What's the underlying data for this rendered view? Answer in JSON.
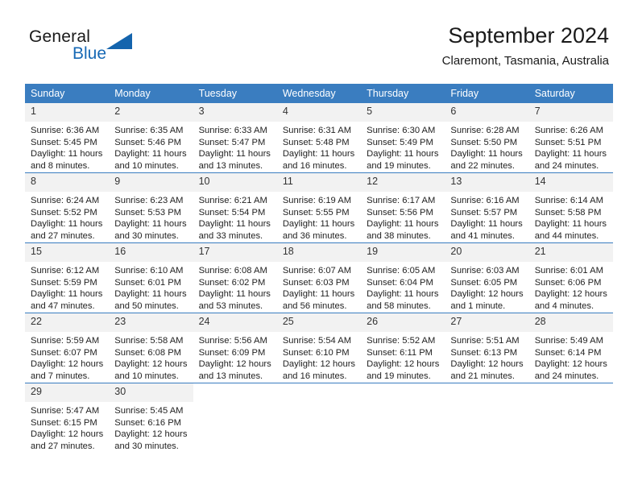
{
  "brand": {
    "name_part1": "General",
    "name_part2": "Blue",
    "triangle_color": "#1464ad",
    "blue_text_color": "#1769b5"
  },
  "header": {
    "title": "September 2024",
    "subtitle": "Claremont, Tasmania, Australia"
  },
  "calendar": {
    "header_bg": "#3a7dc0",
    "header_text_color": "#ffffff",
    "daynum_bg": "#f2f2f2",
    "weekday_headers": [
      "Sunday",
      "Monday",
      "Tuesday",
      "Wednesday",
      "Thursday",
      "Friday",
      "Saturday"
    ],
    "weeks": [
      [
        {
          "day": "1",
          "sunrise": "Sunrise: 6:36 AM",
          "sunset": "Sunset: 5:45 PM",
          "daylight1": "Daylight: 11 hours",
          "daylight2": "and 8 minutes."
        },
        {
          "day": "2",
          "sunrise": "Sunrise: 6:35 AM",
          "sunset": "Sunset: 5:46 PM",
          "daylight1": "Daylight: 11 hours",
          "daylight2": "and 10 minutes."
        },
        {
          "day": "3",
          "sunrise": "Sunrise: 6:33 AM",
          "sunset": "Sunset: 5:47 PM",
          "daylight1": "Daylight: 11 hours",
          "daylight2": "and 13 minutes."
        },
        {
          "day": "4",
          "sunrise": "Sunrise: 6:31 AM",
          "sunset": "Sunset: 5:48 PM",
          "daylight1": "Daylight: 11 hours",
          "daylight2": "and 16 minutes."
        },
        {
          "day": "5",
          "sunrise": "Sunrise: 6:30 AM",
          "sunset": "Sunset: 5:49 PM",
          "daylight1": "Daylight: 11 hours",
          "daylight2": "and 19 minutes."
        },
        {
          "day": "6",
          "sunrise": "Sunrise: 6:28 AM",
          "sunset": "Sunset: 5:50 PM",
          "daylight1": "Daylight: 11 hours",
          "daylight2": "and 22 minutes."
        },
        {
          "day": "7",
          "sunrise": "Sunrise: 6:26 AM",
          "sunset": "Sunset: 5:51 PM",
          "daylight1": "Daylight: 11 hours",
          "daylight2": "and 24 minutes."
        }
      ],
      [
        {
          "day": "8",
          "sunrise": "Sunrise: 6:24 AM",
          "sunset": "Sunset: 5:52 PM",
          "daylight1": "Daylight: 11 hours",
          "daylight2": "and 27 minutes."
        },
        {
          "day": "9",
          "sunrise": "Sunrise: 6:23 AM",
          "sunset": "Sunset: 5:53 PM",
          "daylight1": "Daylight: 11 hours",
          "daylight2": "and 30 minutes."
        },
        {
          "day": "10",
          "sunrise": "Sunrise: 6:21 AM",
          "sunset": "Sunset: 5:54 PM",
          "daylight1": "Daylight: 11 hours",
          "daylight2": "and 33 minutes."
        },
        {
          "day": "11",
          "sunrise": "Sunrise: 6:19 AM",
          "sunset": "Sunset: 5:55 PM",
          "daylight1": "Daylight: 11 hours",
          "daylight2": "and 36 minutes."
        },
        {
          "day": "12",
          "sunrise": "Sunrise: 6:17 AM",
          "sunset": "Sunset: 5:56 PM",
          "daylight1": "Daylight: 11 hours",
          "daylight2": "and 38 minutes."
        },
        {
          "day": "13",
          "sunrise": "Sunrise: 6:16 AM",
          "sunset": "Sunset: 5:57 PM",
          "daylight1": "Daylight: 11 hours",
          "daylight2": "and 41 minutes."
        },
        {
          "day": "14",
          "sunrise": "Sunrise: 6:14 AM",
          "sunset": "Sunset: 5:58 PM",
          "daylight1": "Daylight: 11 hours",
          "daylight2": "and 44 minutes."
        }
      ],
      [
        {
          "day": "15",
          "sunrise": "Sunrise: 6:12 AM",
          "sunset": "Sunset: 5:59 PM",
          "daylight1": "Daylight: 11 hours",
          "daylight2": "and 47 minutes."
        },
        {
          "day": "16",
          "sunrise": "Sunrise: 6:10 AM",
          "sunset": "Sunset: 6:01 PM",
          "daylight1": "Daylight: 11 hours",
          "daylight2": "and 50 minutes."
        },
        {
          "day": "17",
          "sunrise": "Sunrise: 6:08 AM",
          "sunset": "Sunset: 6:02 PM",
          "daylight1": "Daylight: 11 hours",
          "daylight2": "and 53 minutes."
        },
        {
          "day": "18",
          "sunrise": "Sunrise: 6:07 AM",
          "sunset": "Sunset: 6:03 PM",
          "daylight1": "Daylight: 11 hours",
          "daylight2": "and 56 minutes."
        },
        {
          "day": "19",
          "sunrise": "Sunrise: 6:05 AM",
          "sunset": "Sunset: 6:04 PM",
          "daylight1": "Daylight: 11 hours",
          "daylight2": "and 58 minutes."
        },
        {
          "day": "20",
          "sunrise": "Sunrise: 6:03 AM",
          "sunset": "Sunset: 6:05 PM",
          "daylight1": "Daylight: 12 hours",
          "daylight2": "and 1 minute."
        },
        {
          "day": "21",
          "sunrise": "Sunrise: 6:01 AM",
          "sunset": "Sunset: 6:06 PM",
          "daylight1": "Daylight: 12 hours",
          "daylight2": "and 4 minutes."
        }
      ],
      [
        {
          "day": "22",
          "sunrise": "Sunrise: 5:59 AM",
          "sunset": "Sunset: 6:07 PM",
          "daylight1": "Daylight: 12 hours",
          "daylight2": "and 7 minutes."
        },
        {
          "day": "23",
          "sunrise": "Sunrise: 5:58 AM",
          "sunset": "Sunset: 6:08 PM",
          "daylight1": "Daylight: 12 hours",
          "daylight2": "and 10 minutes."
        },
        {
          "day": "24",
          "sunrise": "Sunrise: 5:56 AM",
          "sunset": "Sunset: 6:09 PM",
          "daylight1": "Daylight: 12 hours",
          "daylight2": "and 13 minutes."
        },
        {
          "day": "25",
          "sunrise": "Sunrise: 5:54 AM",
          "sunset": "Sunset: 6:10 PM",
          "daylight1": "Daylight: 12 hours",
          "daylight2": "and 16 minutes."
        },
        {
          "day": "26",
          "sunrise": "Sunrise: 5:52 AM",
          "sunset": "Sunset: 6:11 PM",
          "daylight1": "Daylight: 12 hours",
          "daylight2": "and 19 minutes."
        },
        {
          "day": "27",
          "sunrise": "Sunrise: 5:51 AM",
          "sunset": "Sunset: 6:13 PM",
          "daylight1": "Daylight: 12 hours",
          "daylight2": "and 21 minutes."
        },
        {
          "day": "28",
          "sunrise": "Sunrise: 5:49 AM",
          "sunset": "Sunset: 6:14 PM",
          "daylight1": "Daylight: 12 hours",
          "daylight2": "and 24 minutes."
        }
      ],
      [
        {
          "day": "29",
          "sunrise": "Sunrise: 5:47 AM",
          "sunset": "Sunset: 6:15 PM",
          "daylight1": "Daylight: 12 hours",
          "daylight2": "and 27 minutes."
        },
        {
          "day": "30",
          "sunrise": "Sunrise: 5:45 AM",
          "sunset": "Sunset: 6:16 PM",
          "daylight1": "Daylight: 12 hours",
          "daylight2": "and 30 minutes."
        },
        {
          "day": "",
          "sunrise": "",
          "sunset": "",
          "daylight1": "",
          "daylight2": ""
        },
        {
          "day": "",
          "sunrise": "",
          "sunset": "",
          "daylight1": "",
          "daylight2": ""
        },
        {
          "day": "",
          "sunrise": "",
          "sunset": "",
          "daylight1": "",
          "daylight2": ""
        },
        {
          "day": "",
          "sunrise": "",
          "sunset": "",
          "daylight1": "",
          "daylight2": ""
        },
        {
          "day": "",
          "sunrise": "",
          "sunset": "",
          "daylight1": "",
          "daylight2": ""
        }
      ]
    ]
  }
}
